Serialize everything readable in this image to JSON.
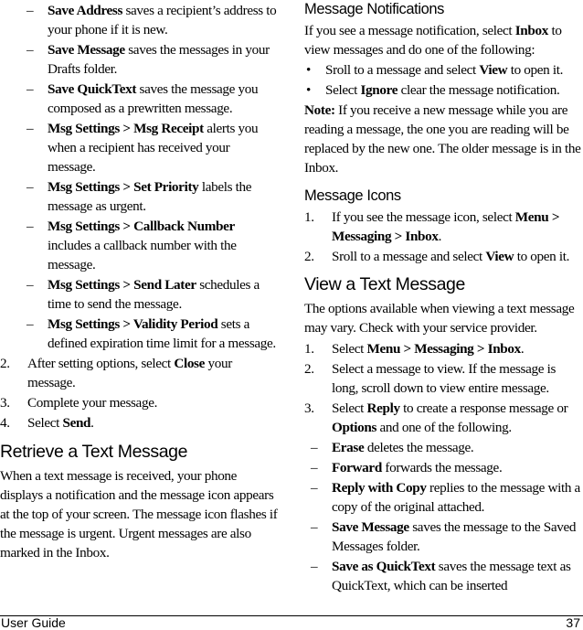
{
  "left": {
    "options": [
      {
        "bold": "Save Address",
        "text": " saves a recipient’s address to your phone if it is new."
      },
      {
        "bold": "Save Message",
        "text": " saves the messages in your Drafts folder."
      },
      {
        "bold": "Save QuickText",
        "text": " saves the message you composed as a prewritten message."
      },
      {
        "bold": "Msg Settings > Msg Receipt",
        "text": " alerts you when a recipient has received your message."
      },
      {
        "bold": "Msg Settings > Set Priority",
        "text": " labels the message as urgent."
      },
      {
        "bold": "Msg Settings > Callback Number",
        "text": " includes a callback number with the message."
      },
      {
        "bold": "Msg Settings > Send Later",
        "text": " schedules a time to send the message."
      },
      {
        "bold": "Msg Settings > Validity Period",
        "text": " sets a defined expiration time limit for a message."
      }
    ],
    "dash": "–",
    "steps": [
      {
        "num": "2.",
        "pre": "After setting options, select ",
        "bold": "Close",
        "post": " your message."
      },
      {
        "num": "3.",
        "pre": "Complete your message.",
        "bold": "",
        "post": ""
      },
      {
        "num": "4.",
        "pre": "Select ",
        "bold": "Send",
        "post": "."
      }
    ],
    "retrieve": {
      "heading": "Retrieve a Text Message",
      "body": "When a text message is received, your phone displays a notification and the message icon appears at the top of your screen. The message icon flashes if the message is urgent. Urgent messages are also marked in the Inbox."
    }
  },
  "right": {
    "notifications": {
      "heading": "Message Notifications",
      "intro_pre": "If you see a message notification, select ",
      "intro_bold": "Inbox",
      "intro_post": " to view messages and do one of the following:",
      "bullet": "•",
      "bullets": [
        {
          "pre": "Sroll to a message and select ",
          "bold": "View",
          "post": " to open it."
        },
        {
          "pre": "Select ",
          "bold": "Ignore",
          "post": " clear the message notification."
        }
      ],
      "note_label": "Note:",
      "note_text": " If you receive a new message while you are reading a message, the one you are reading will be replaced by the new one. The older message is in the Inbox."
    },
    "icons": {
      "heading": "Message Icons",
      "steps": [
        {
          "num": "1.",
          "pre": "If you see the message icon, select ",
          "bold": "Menu > Messaging > Inbox",
          "post": "."
        },
        {
          "num": "2.",
          "pre": "Sroll to a message and select ",
          "bold": "View",
          "post": " to open it."
        }
      ]
    },
    "view": {
      "heading": "View a Text Message",
      "intro": "The options available when viewing a text message may vary. Check with your service provider.",
      "steps": [
        {
          "num": "1.",
          "pre": "Select ",
          "bold": "Menu > Messaging > Inbox",
          "post": "."
        },
        {
          "num": "2.",
          "pre": "Select a message to view. If the message is long, scroll down to view entire message.",
          "bold": "",
          "post": ""
        }
      ],
      "step3": {
        "num": "3.",
        "pre": "Select ",
        "bold1": "Reply",
        "mid": " to create a response message or ",
        "bold2": "Options",
        "post": " and one of the following."
      },
      "options": [
        {
          "bold": "Erase",
          "text": " deletes the message."
        },
        {
          "bold": "Forward",
          "text": " forwards the message."
        },
        {
          "bold": "Reply with Copy",
          "text": " replies to the message with a copy of the original attached."
        },
        {
          "bold": "Save Message",
          "text": " saves the message to the Saved Messages folder."
        },
        {
          "bold": "Save as QuickText",
          "text": " saves the message text as QuickText, which can be inserted"
        }
      ]
    }
  },
  "footer": {
    "title": "User Guide",
    "page": "37"
  }
}
